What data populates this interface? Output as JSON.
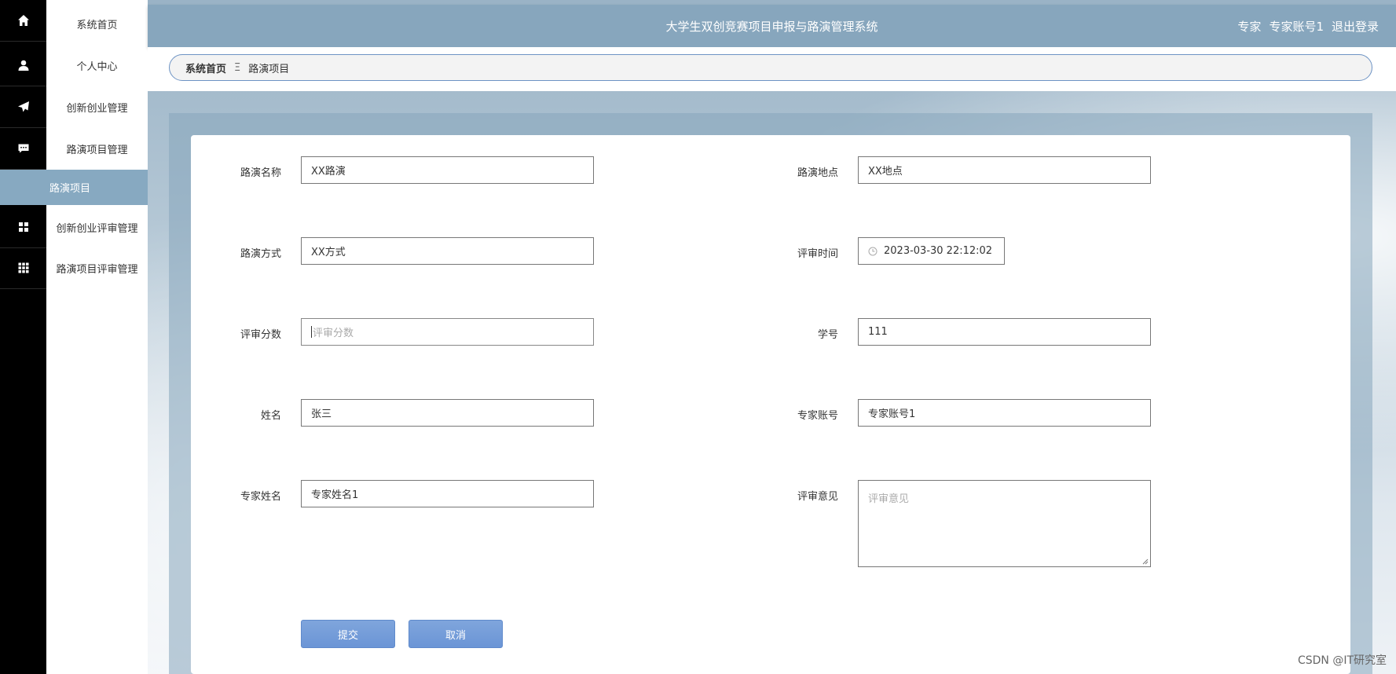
{
  "app": {
    "title": "大学生双创竞赛项目申报与路演管理系统",
    "user_role": "专家",
    "user_name": "专家账号1",
    "logout": "退出登录"
  },
  "sidebar": {
    "items": [
      {
        "label": "系统首页",
        "icon": "home-icon"
      },
      {
        "label": "个人中心",
        "icon": "user-icon"
      },
      {
        "label": "创新创业管理",
        "icon": "paper-plane-icon"
      },
      {
        "label": "路演项目管理",
        "icon": "chat-icon"
      },
      {
        "label": "创新创业评审管理",
        "icon": "grid-icon"
      },
      {
        "label": "路演项目评审管理",
        "icon": "apps-icon"
      }
    ],
    "active_sub": "路演项目"
  },
  "breadcrumb": {
    "home": "系统首页",
    "separator": "Ξ",
    "current": "路演项目"
  },
  "form": {
    "roadshow_name": {
      "label": "路演名称",
      "value": "XX路演"
    },
    "roadshow_location": {
      "label": "路演地点",
      "value": "XX地点"
    },
    "roadshow_method": {
      "label": "路演方式",
      "value": "XX方式"
    },
    "review_time": {
      "label": "评审时间",
      "value": "2023-03-30 22:12:02"
    },
    "review_score": {
      "label": "评审分数",
      "value": "",
      "placeholder": "评审分数"
    },
    "student_id": {
      "label": "学号",
      "value": "111"
    },
    "name": {
      "label": "姓名",
      "value": "张三"
    },
    "expert_account": {
      "label": "专家账号",
      "value": "专家账号1"
    },
    "expert_name": {
      "label": "专家姓名",
      "value": "专家姓名1"
    },
    "review_opinion": {
      "label": "评审意见",
      "value": "",
      "placeholder": "评审意见"
    },
    "submit": "提交",
    "cancel": "取消"
  },
  "watermark": "CSDN @IT研究室",
  "colors": {
    "topbar": "#87a6bd",
    "active_sub": "#87a9c1",
    "button": "#6b95d6",
    "breadcrumb_border": "#6d93c4"
  }
}
